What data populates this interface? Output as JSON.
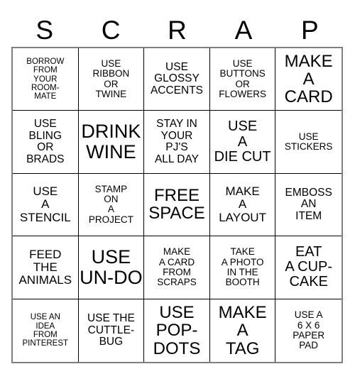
{
  "card": {
    "title_letters": [
      "S",
      "C",
      "R",
      "A",
      "P"
    ],
    "colors": {
      "background": "#ffffff",
      "text": "#000000",
      "cell_border": "#000000",
      "outer_border": "#7f7f7f"
    },
    "grid": {
      "columns": 5,
      "rows": 5,
      "free_space_index": 12
    },
    "cells": [
      {
        "text": "BORROW\nFROM\nYOUR\nROOM-\nMATE",
        "size": "xs"
      },
      {
        "text": "USE\nRIBBON\nOR\nTWINE",
        "size": "s"
      },
      {
        "text": "USE\nGLOSSY\nACCENTS",
        "size": "m"
      },
      {
        "text": "USE\nBUTTONS\nOR\nFLOWERS",
        "size": "s"
      },
      {
        "text": "MAKE\nA\nCARD",
        "size": "xl"
      },
      {
        "text": "USE\nBLING\nOR\nBRADS",
        "size": "m"
      },
      {
        "text": "DRINK\nWINE",
        "size": "xxl"
      },
      {
        "text": "STAY IN\nYOUR\nPJ'S\nALL DAY",
        "size": "m"
      },
      {
        "text": "USE\nA\nDIE CUT",
        "size": "l"
      },
      {
        "text": "USE\nSTICKERS",
        "size": "s"
      },
      {
        "text": "USE\nA\nSTENCIL",
        "size": "ml"
      },
      {
        "text": "STAMP\nON\nA\nPROJECT",
        "size": "s"
      },
      {
        "text": "FREE\nSPACE",
        "size": "xl"
      },
      {
        "text": "MAKE\nA\nLAYOUT",
        "size": "ml"
      },
      {
        "text": "EMBOSS\nAN\nITEM",
        "size": "m"
      },
      {
        "text": "FEED\nTHE\nANIMALS",
        "size": "ml"
      },
      {
        "text": "USE\nUN-DO",
        "size": "xxl"
      },
      {
        "text": "MAKE\nA CARD\nFROM\nSCRAPS",
        "size": "s"
      },
      {
        "text": "TAKE\nA PHOTO\nIN THE\nBOOTH",
        "size": "s"
      },
      {
        "text": "EAT\nA CUP-\nCAKE",
        "size": "l"
      },
      {
        "text": "USE AN\nIDEA\nFROM\nPINTEREST",
        "size": "xs"
      },
      {
        "text": "USE THE\nCUTTLE-\nBUG",
        "size": "m"
      },
      {
        "text": "USE\nPOP-\nDOTS",
        "size": "xl"
      },
      {
        "text": "MAKE\nA\nTAG",
        "size": "xl"
      },
      {
        "text": "USE A\n6 X 6\nPAPER\nPAD",
        "size": "s"
      }
    ]
  }
}
